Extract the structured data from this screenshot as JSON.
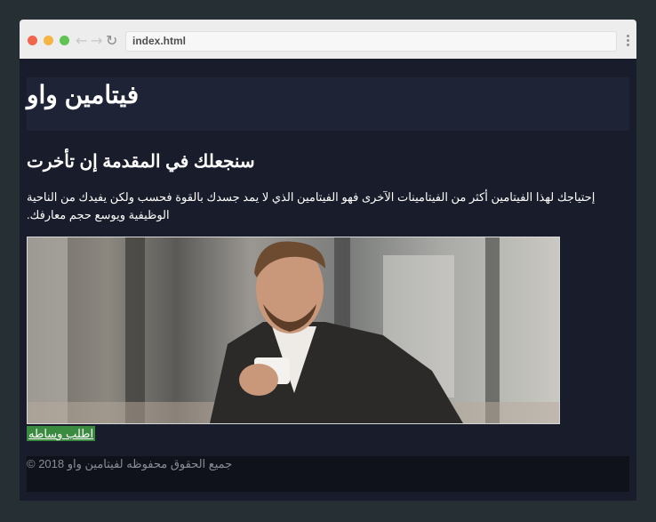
{
  "browser": {
    "url": "index.html"
  },
  "page": {
    "site_title": "فيتامين واو",
    "subtitle": "سنجعلك في المقدمة إن تأخرت",
    "description": "إحتياجك لهذا الفيتامين أكثر من الفيتامينات الآخرى فهو الفيتامين الذي لا يمد جسدك بالقوة فحسب ولكن يفيدك من الناحية الوظيفية ويوسع حجم معارفك.",
    "cta_label": "اطلب وساطه",
    "footer_text": "جميع الحقوق محفوظه لفيتامين واو 2018 ©"
  },
  "colors": {
    "page_background": "#191c2a",
    "header_background": "#1f2336",
    "footer_background": "#0f111b",
    "cta_background": "#3a8b3f"
  },
  "icons": {
    "back": "arrow-left-icon",
    "forward": "arrow-right-icon",
    "reload": "reload-icon",
    "menu": "kebab-menu-icon"
  }
}
